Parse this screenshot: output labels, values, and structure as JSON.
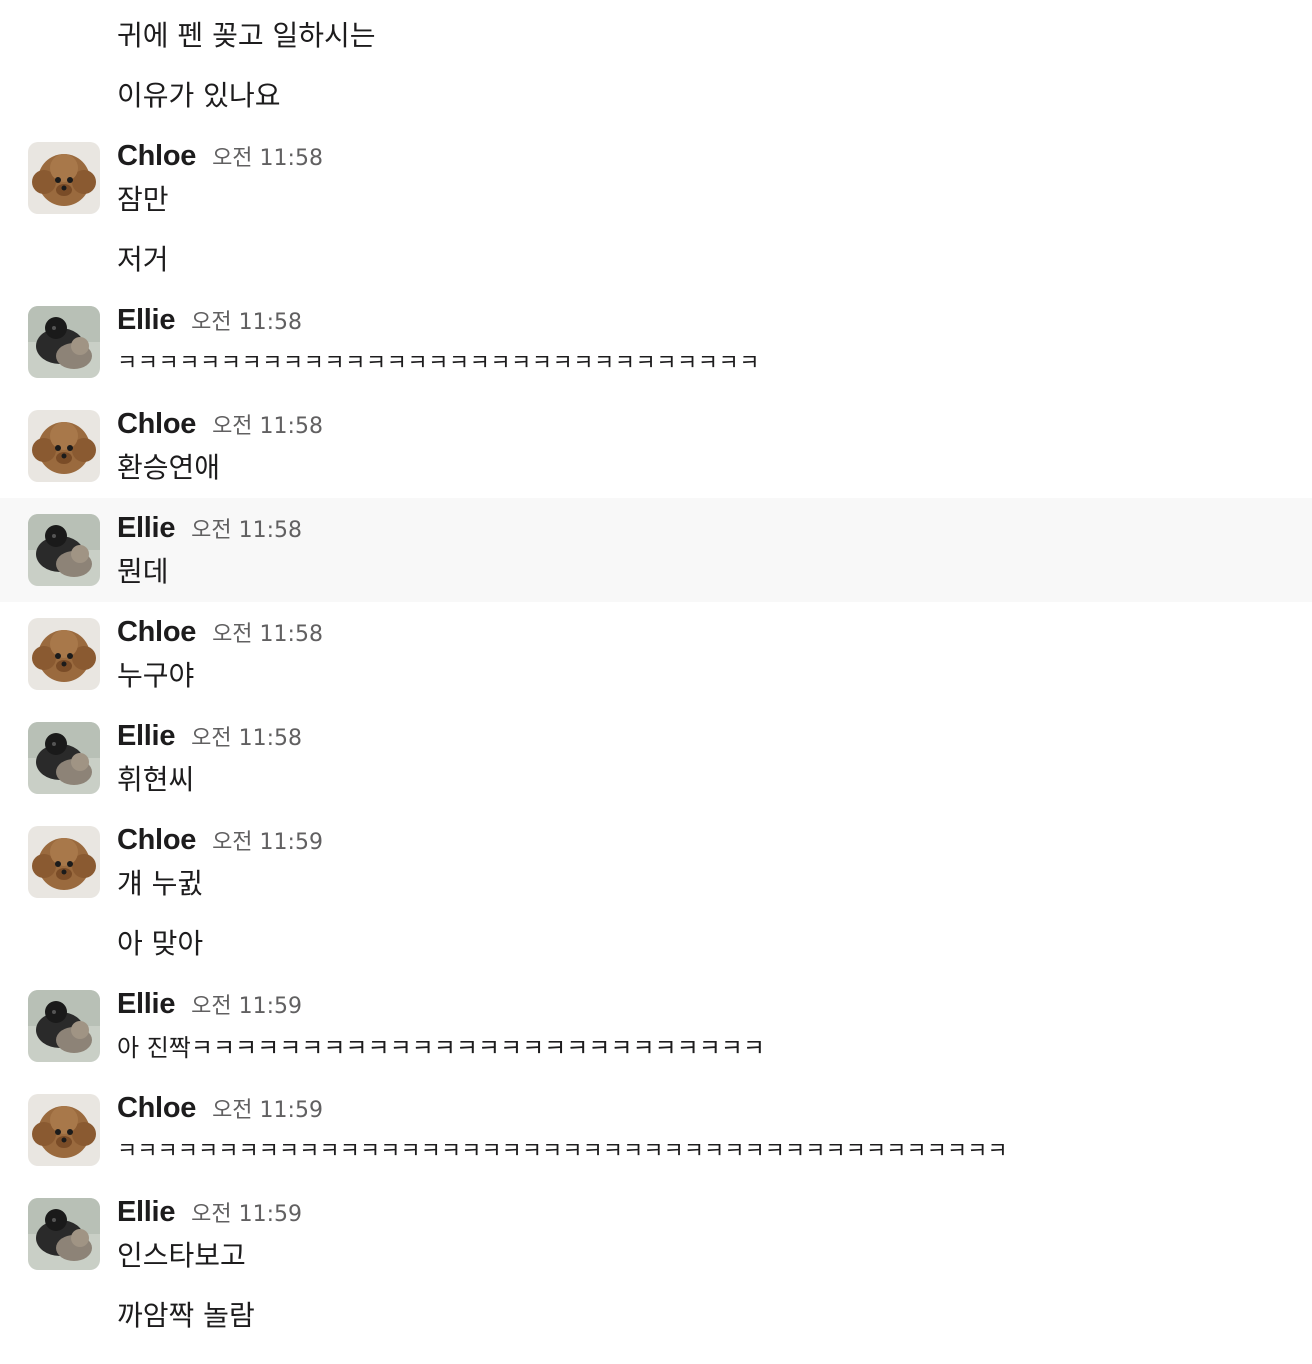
{
  "messages": [
    {
      "text": "귀에 펜 꽂고 일하시는"
    },
    {
      "text": "이유가 있나요"
    },
    {
      "sender": "Chloe",
      "time": "오전 11:58",
      "avatar": "poodle-avatar",
      "lines": [
        "잠만",
        "저거"
      ]
    },
    {
      "sender": "Ellie",
      "time": "오전 11:58",
      "avatar": "dogs-avatar",
      "lines": [
        "ㅋㅋㅋㅋㅋㅋㅋㅋㅋㅋㅋㅋㅋㅋㅋㅋㅋㅋㅋㅋㅋㅋㅋㅋㅋㅋㅋㅋㅋㅋㅋ"
      ]
    },
    {
      "sender": "Chloe",
      "time": "오전 11:58",
      "avatar": "poodle-avatar",
      "lines": [
        "환승연애"
      ]
    },
    {
      "sender": "Ellie",
      "time": "오전 11:58",
      "avatar": "dogs-avatar",
      "lines": [
        "뭔데"
      ],
      "highlighted": true
    },
    {
      "sender": "Chloe",
      "time": "오전 11:58",
      "avatar": "poodle-avatar",
      "lines": [
        "누구야"
      ]
    },
    {
      "sender": "Ellie",
      "time": "오전 11:58",
      "avatar": "dogs-avatar",
      "lines": [
        "휘현씨"
      ]
    },
    {
      "sender": "Chloe",
      "time": "오전 11:59",
      "avatar": "poodle-avatar",
      "lines": [
        "걔 누귌",
        "아 맞아"
      ]
    },
    {
      "sender": "Ellie",
      "time": "오전 11:59",
      "avatar": "dogs-avatar",
      "lines": [
        "아 진짝ㅋㅋㅋㅋㅋㅋㅋㅋㅋㅋㅋㅋㅋㅋㅋㅋㅋㅋㅋㅋㅋㅋㅋㅋㅋㅋ"
      ]
    },
    {
      "sender": "Chloe",
      "time": "오전 11:59",
      "avatar": "poodle-avatar",
      "lines": [
        "ㅋㅋㅋㅋㅋㅋㅋㅋㅋㅋㅋㅋㅋㅋㅋㅋㅋㅋㅋㅋㅋㅋㅋㅋㅋㅋㅋㅋㅋㅋㅋㅋㅋㅋㅋㅋㅋㅋㅋㅋㅋㅋㅋㅋ"
      ]
    },
    {
      "sender": "Ellie",
      "time": "오전 11:59",
      "avatar": "dogs-avatar",
      "lines": [
        "인스타보고",
        "까암짝 놀람"
      ]
    }
  ]
}
